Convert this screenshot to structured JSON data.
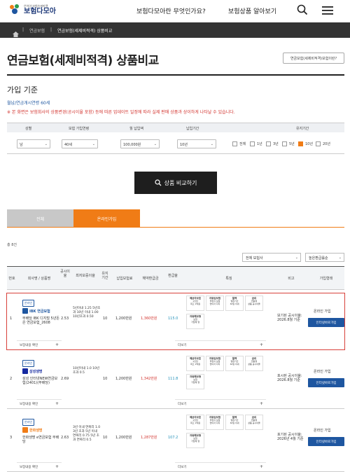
{
  "header": {
    "logo_small": "은어야 보험슈퍼마켓",
    "logo_big": "보험다모아",
    "nav": [
      "보험다모아란 무엇인가요?",
      "보험상품 알아보기"
    ]
  },
  "breadcrumb": [
    "연금보험",
    "연금보험(세제비적격) 상품비교"
  ],
  "page": {
    "title": "연금보험(세제비적격) 상품비교",
    "what_button": "연금보험(세제비적격)보험이란?",
    "section": "가입 기준",
    "criteria": "월납/연금개시연령 60세",
    "notice": "※ 본 화면은 보험회사의 상품변경(공시이율 포함) 등에 따른 업데이트 일정에 따라 실제 판매 상품과 상이하게 나타날 수 있습니다."
  },
  "filters": {
    "headers": [
      "성별",
      "보험 가입연령",
      "월 납입액",
      "납입기간",
      "유지기간"
    ],
    "gender": "남",
    "age": "40세",
    "premium": "100,000원",
    "period": "10년",
    "keep_options": [
      {
        "label": "전체",
        "checked": false
      },
      {
        "label": "1년",
        "checked": false
      },
      {
        "label": "3년",
        "checked": false
      },
      {
        "label": "5년",
        "checked": false
      },
      {
        "label": "10년",
        "checked": true
      },
      {
        "label": "20년",
        "checked": false
      }
    ]
  },
  "compare_button": "상품 비교하기",
  "tabs": [
    "전체",
    "온라인가입"
  ],
  "result_count": "총 8건",
  "sort": {
    "company": "전체 보험사",
    "order": "높은환급률순"
  },
  "table": {
    "headers": [
      "번호",
      "회사명 / 상품명",
      "공시이율",
      "최저보증이율",
      "유지기간",
      "납입보험료",
      "해약환급금",
      "환급율",
      "특징",
      "비고",
      "가입형태"
    ],
    "rows": [
      {
        "no": "1",
        "badge": "온라인",
        "company": "IBK 연금보험",
        "product": "무배당 IBK 디지털 5년돈은 연금보험_2608",
        "rate": "2.53",
        "min_rate": "5년이내 1.25 5년초과 10년 이내 1.00 10년초과 0.50",
        "keep": "10",
        "premium": "1,200만원",
        "refund": "1,360만원",
        "ratio": "115.0",
        "note": "보기된 공시이율: 2026.8월 기준",
        "join": "온라인 가입",
        "join_button": "인터넷바로가입",
        "more_left": "보장내용 확인",
        "more_right": "더보기"
      },
      {
        "no": "2",
        "badge": "온라인",
        "company": "삼성생명",
        "product": "삼성 인터넷NEW연금보험(2401)(무배당)",
        "rate": "2.69",
        "min_rate": "10년이내 1.0 10년초과 0.5",
        "keep": "10",
        "premium": "1,200만원",
        "refund": "1,342만원",
        "ratio": "111.8",
        "note": "포시된 공시이율: 2026.8월 기준",
        "join": "온라인 가입",
        "join_button": "인터넷바로가입",
        "more_left": "보장내용 확인",
        "more_right": "더보기"
      },
      {
        "no": "3",
        "badge": "온라인",
        "company": "한화생명",
        "product": "한화생명 e연금보험 무배당",
        "rate": "2.63",
        "min_rate": "3년 이내 연복리 1.0 3년 초과 5년 이내 연복리 0.75 5년 초과 연복리 0.5",
        "keep": "10",
        "premium": "1,200만원",
        "refund": "1,287만원",
        "ratio": "107.2",
        "note": "포기된 공시이율: 2026년 4월 기준",
        "join": "온라인 가입",
        "join_button": "인터넷바로가입",
        "more_left": "보장내용 확인",
        "more_right": "더보기"
      }
    ],
    "features": [
      {
        "top": "예금자보호",
        "mid": "1인당",
        "bot": "최고 1억원"
      },
      {
        "top": "자유입보험",
        "mid": "적립식 보험",
        "bot": "연이자 다지"
      },
      {
        "top": "월액",
        "mid": "월환기간",
        "bot": "30일 이내"
      },
      {
        "top": "금리",
        "mid": "연동형",
        "bot": "상품 공시이율"
      },
      {
        "top": "자유해보형",
        "mid": "보험",
        "bot": "가입제 형"
      }
    ]
  }
}
